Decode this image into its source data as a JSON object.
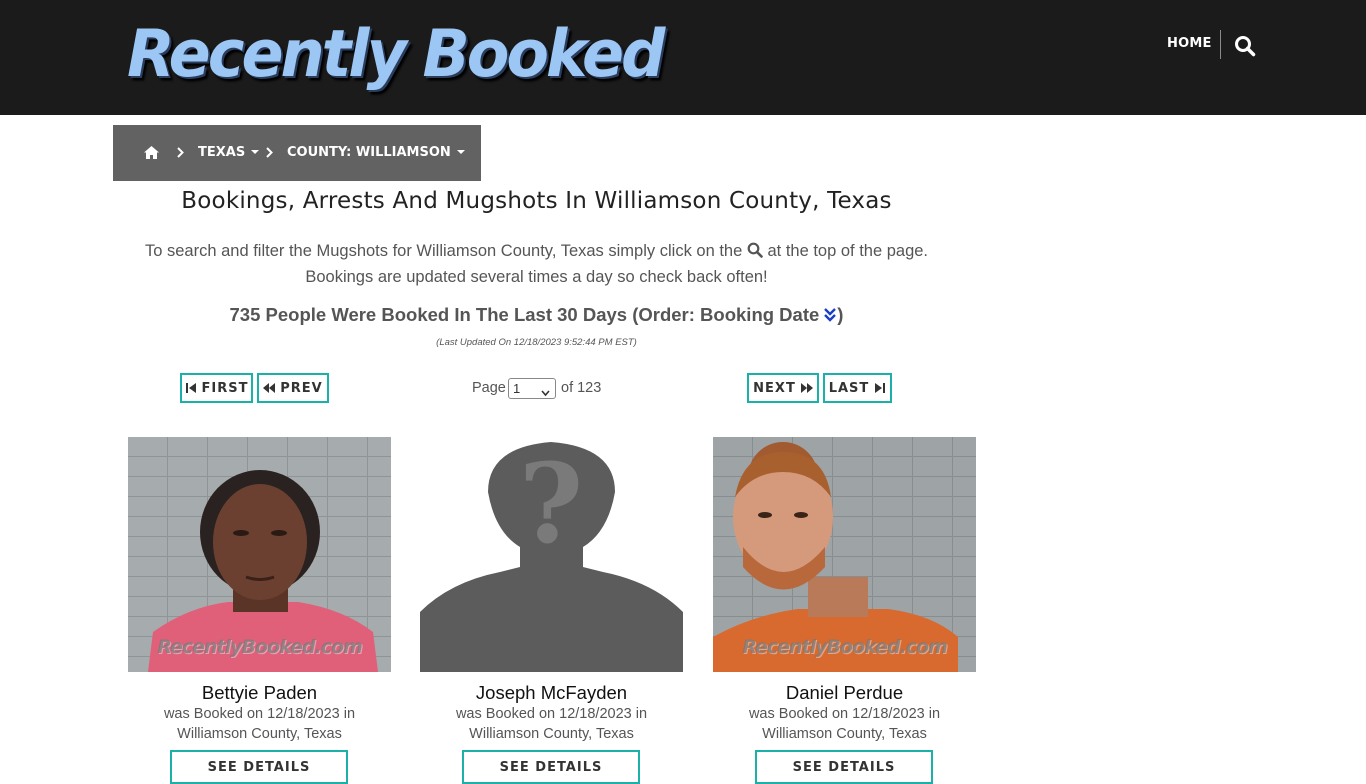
{
  "header": {
    "logo_text": "Recently Booked",
    "nav_home": "HOME",
    "search_icon": "search-icon"
  },
  "breadcrumb": {
    "home_icon": "home-icon",
    "state": "TEXAS",
    "county": "COUNTY: WILLIAMSON"
  },
  "main": {
    "title": "Bookings, Arrests And Mugshots In Williamson County, Texas",
    "desc_part1": "To search and filter the Mugshots for Williamson County, Texas simply click on the",
    "desc_part2": "at the top of the page.",
    "desc_line2": "Bookings are updated several times a day so check back often!",
    "count_text": "735 People Were Booked In The Last 30 Days (Order: Booking Date",
    "count_close": ")",
    "updated": "(Last Updated On 12/18/2023 9:52:44 PM EST)"
  },
  "pagination": {
    "first": "FIRST",
    "prev": "PREV",
    "page_label": "Page",
    "page_value": "1",
    "page_of": "of 123",
    "next": "NEXT",
    "last": "LAST"
  },
  "bookings": [
    {
      "name": "Bettyie Paden",
      "line1": "was Booked on 12/18/2023 in",
      "line2": "Williamson County, Texas",
      "details": "SEE DETAILS",
      "watermark": "RecentlyBooked.com"
    },
    {
      "name": "Joseph McFayden",
      "line1": "was Booked on 12/18/2023 in",
      "line2": "Williamson County, Texas",
      "details": "SEE DETAILS",
      "watermark": ""
    },
    {
      "name": "Daniel Perdue",
      "line1": "was Booked on 12/18/2023 in",
      "line2": "Williamson County, Texas",
      "details": "SEE DETAILS",
      "watermark": "RecentlyBooked.com"
    }
  ],
  "colors": {
    "header_bg": "#1b1b1b",
    "breadcrumb_bg": "#626262",
    "accent": "#1bb0a8",
    "logo": "#9cc6f4"
  }
}
